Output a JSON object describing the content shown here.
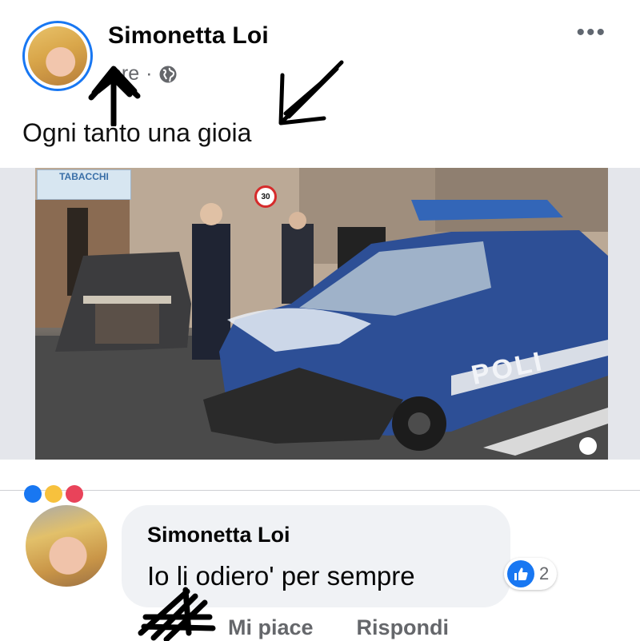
{
  "post": {
    "author": "Simonetta Loi",
    "time": "ore",
    "separator": "·",
    "text": "Ogni tanto una gioia",
    "more_label": "•••",
    "photo": {
      "shop_sign": "TABACCHI",
      "speed_limit": "30",
      "car_text": "POLI"
    }
  },
  "comment": {
    "author": "Simonetta Loi",
    "text": "Io li odiero' per sempre",
    "like_count": "2",
    "actions": {
      "like": "Mi piace",
      "reply": "Rispondi"
    }
  },
  "colors": {
    "accent": "#1877f2",
    "bubble": "#f0f2f5",
    "muted": "#65676b"
  },
  "icons": [
    "globe-icon",
    "more-icon",
    "like-icon"
  ]
}
